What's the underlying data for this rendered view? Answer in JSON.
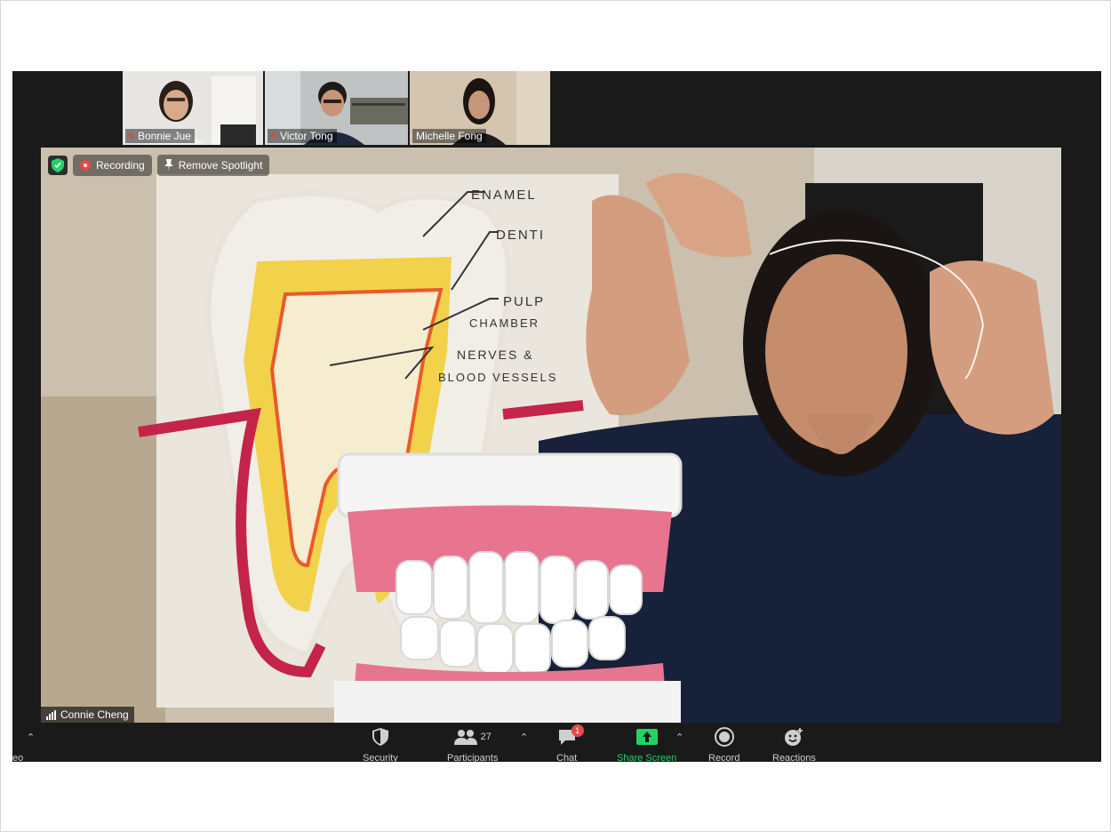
{
  "participants_thumbs": [
    {
      "name": "Bonnie Jue",
      "muted": true
    },
    {
      "name": "Victor Tong",
      "muted": true
    },
    {
      "name": "Michelle Fong",
      "muted": false
    }
  ],
  "overlay": {
    "recording_label": "Recording",
    "remove_spotlight_label": "Remove Spotlight"
  },
  "active_speaker": "Connie Cheng",
  "drawing_labels": {
    "enamel": "ENAMEL",
    "dentin": "DENTI",
    "pulp": "PULP",
    "chamber": "CHAMBER",
    "nerves": "NERVES &",
    "vessels": "BLOOD VESSELS"
  },
  "toolbar": {
    "video_partial_label": "eo",
    "security_label": "Security",
    "participants_label": "Participants",
    "participants_count": "27",
    "chat_label": "Chat",
    "chat_badge": "1",
    "share_label": "Share Screen",
    "record_label": "Record",
    "reactions_label": "Reactions"
  },
  "colors": {
    "toolbar_bg": "#1a1a1a",
    "share_green": "#23d366",
    "badge_red": "#e8484a"
  }
}
